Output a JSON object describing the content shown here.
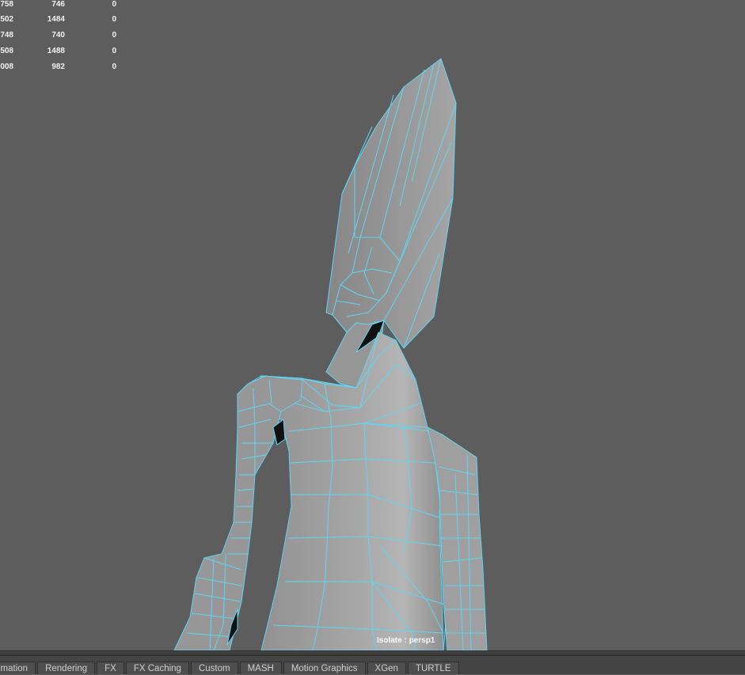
{
  "hud": {
    "rows": [
      [
        "758",
        "746",
        "0"
      ],
      [
        "502",
        "1484",
        "0"
      ],
      [
        "748",
        "740",
        "0"
      ],
      [
        "508",
        "1488",
        "0"
      ],
      [
        "008",
        "982",
        "0"
      ]
    ]
  },
  "viewport": {
    "isolate_label": "Isolate : persp1",
    "wire_color": "#5fd6f5",
    "mesh_color": "#9b9b9b",
    "background_color": "#5d5d5d"
  },
  "shelf": {
    "tabs": [
      "imation",
      "Rendering",
      "FX",
      "FX Caching",
      "Custom",
      "MASH",
      "Motion Graphics",
      "XGen",
      "TURTLE"
    ]
  }
}
